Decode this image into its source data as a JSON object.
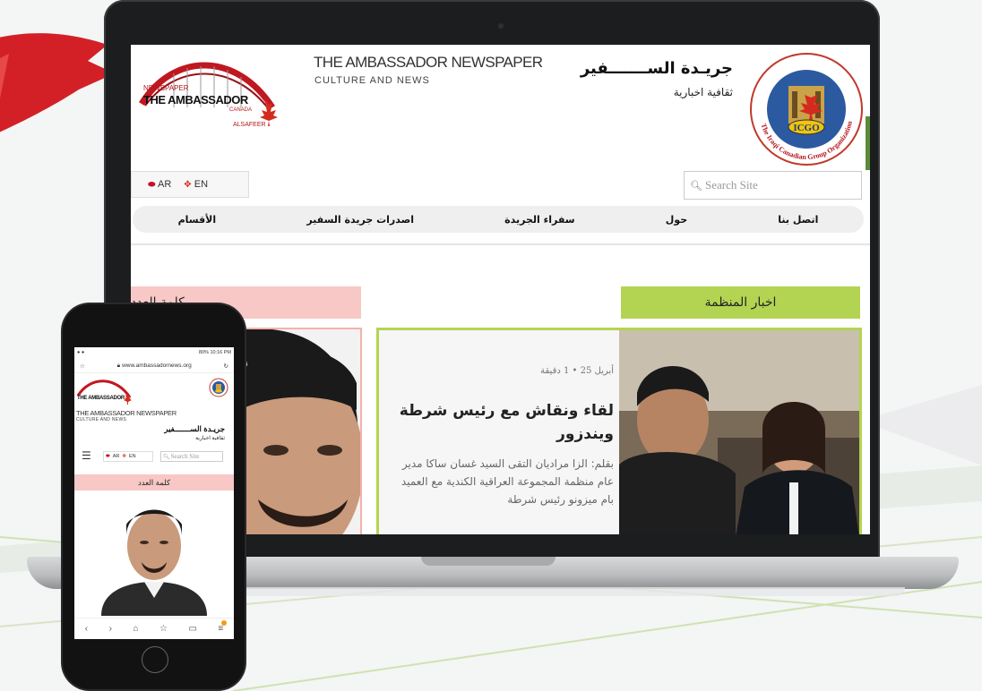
{
  "desktop": {
    "logo": {
      "newspaper": "NEWSPAPER",
      "name": "THE AMBASSADOR",
      "canada": "CANADA",
      "alsafeer": "ALSAFEER"
    },
    "title_en": "THE AMBASSADOR NEWSPAPER",
    "subtitle_en": "CULTURE AND NEWS",
    "title_ar": "جريـدة الســـــــفير",
    "subtitle_ar": "ثقافية اخبارية",
    "lang": {
      "ar": "AR",
      "en": "EN"
    },
    "search_placeholder": "Search Site",
    "nav": [
      "الأقسام",
      "اصدرات جريدة السفير",
      "سفراء الجريدة",
      "حول",
      "اتصل بنا"
    ],
    "section_org_news": "اخبار المنظمة",
    "section_editorial": "كلمة العدد",
    "post": {
      "date": "أبريل 25  •  1 دقيقة",
      "title": "لقاء ونقاش مع رئيس شرطة ويندزور",
      "excerpt": "بقلم: الزا مراديان التقى السيد غسان ساكا مدير عام منظمة المجموعة العراقية الكندية مع العميد بام ميزونو رئيس شرطة"
    }
  },
  "phone": {
    "status_right": "80% 10:16 PM",
    "url": "www.ambassadornews.org",
    "logo_name": "THE AMBASSADOR",
    "title_en": "THE AMBASSADOR NEWSPAPER",
    "subtitle_en": "CULTURE AND NEWS",
    "title_ar": "جريـدة الســـــــفير",
    "subtitle_ar": "ثقافية اخبارية",
    "lang": {
      "ar": "AR",
      "en": "EN"
    },
    "search_placeholder": "Search Site",
    "section_editorial": "كلمة العدد"
  },
  "colors": {
    "green": "#b3d452",
    "pink": "#f7c8c5",
    "brand_red": "#b5161b"
  }
}
